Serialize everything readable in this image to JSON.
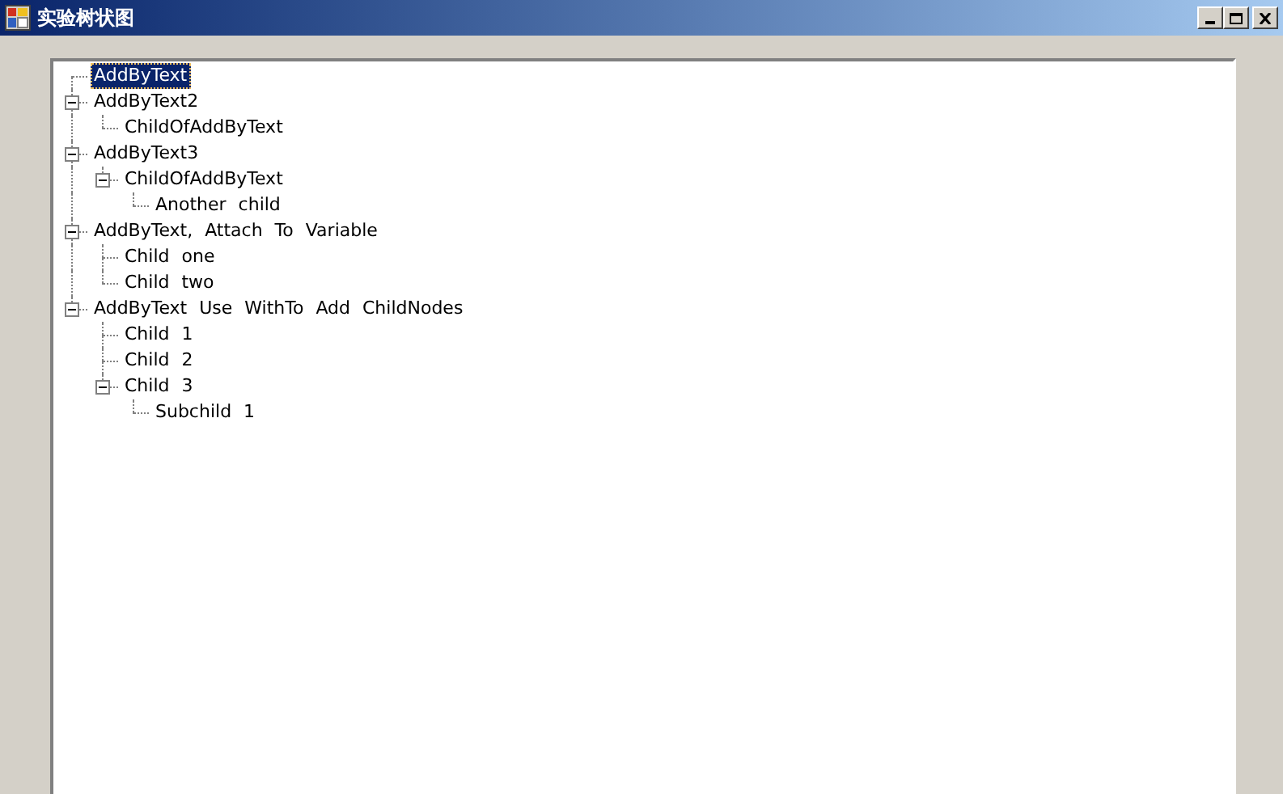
{
  "window": {
    "title": "实验树状图"
  },
  "tree": {
    "nodes": [
      {
        "label": "AddByText",
        "selected": true
      },
      {
        "label": "AddByText2",
        "selected": false,
        "expanded": true,
        "children": [
          {
            "label": "ChildOfAddByText",
            "selected": false
          }
        ]
      },
      {
        "label": "AddByText3",
        "selected": false,
        "expanded": true,
        "children": [
          {
            "label": "ChildOfAddByText",
            "selected": false,
            "expanded": true,
            "children": [
              {
                "label": "Another child",
                "selected": false
              }
            ]
          }
        ]
      },
      {
        "label": "AddByText, Attach To Variable",
        "selected": false,
        "expanded": true,
        "children": [
          {
            "label": "Child one",
            "selected": false
          },
          {
            "label": "Child two",
            "selected": false
          }
        ]
      },
      {
        "label": "AddByText Use WithTo Add ChildNodes",
        "selected": false,
        "expanded": true,
        "children": [
          {
            "label": "Child 1",
            "selected": false
          },
          {
            "label": "Child 2",
            "selected": false
          },
          {
            "label": "Child 3",
            "selected": false,
            "expanded": true,
            "children": [
              {
                "label": "Subchild 1",
                "selected": false
              }
            ]
          }
        ]
      }
    ]
  }
}
